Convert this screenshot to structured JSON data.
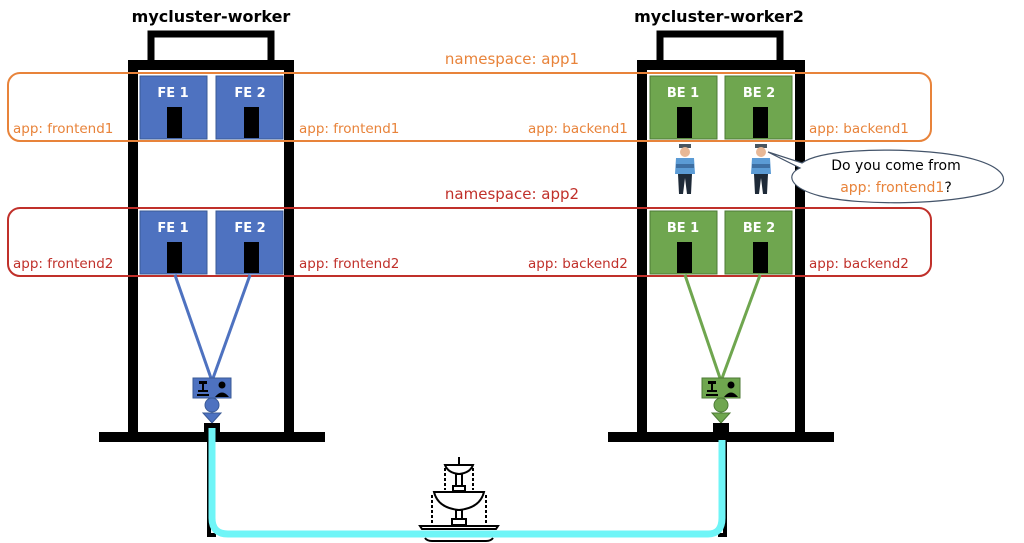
{
  "diagram": {
    "colors": {
      "namespace1": "#e8833a",
      "namespace2": "#c0302a",
      "frontend_pod": "#4e72c0",
      "backend_pod": "#6fa64f",
      "frontend_link": "#4e72c0",
      "backend_link": "#6fa64f",
      "network": "#6ff5f7",
      "structure": "#000000"
    },
    "nodes": [
      {
        "name": "mycluster-worker"
      },
      {
        "name": "mycluster-worker2"
      }
    ],
    "namespaces": [
      {
        "label": "namespace: app1",
        "left_labels": [
          "app: frontend1",
          "app: backend1"
        ],
        "right_labels": [
          "app: frontend1",
          "app: backend1"
        ],
        "pods_node1": [
          "FE 1",
          "FE 2"
        ],
        "pods_node2": [
          "BE 1",
          "BE 2"
        ]
      },
      {
        "label": "namespace: app2",
        "left_labels": [
          "app: frontend2",
          "app: backend2"
        ],
        "right_labels": [
          "app: frontend2",
          "app: backend2"
        ],
        "pods_node1": [
          "FE 1",
          "FE 2"
        ],
        "pods_node2": [
          "BE 1",
          "BE 2"
        ]
      }
    ],
    "guards": [
      "police-officer",
      "police-officer"
    ],
    "speech_bubble": {
      "line1": "Do you come from",
      "highlight": "app: frontend1",
      "suffix": "?"
    },
    "network_icon": "fountain-icon",
    "service_icons": [
      "fountain-icon",
      "person-icon"
    ]
  }
}
